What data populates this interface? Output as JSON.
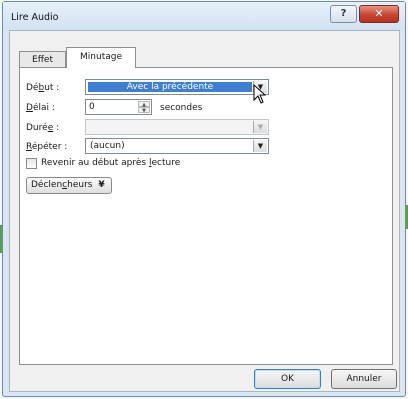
{
  "window": {
    "title": "Lire Audio",
    "help_label": "?",
    "close_label": "✕"
  },
  "tabs": [
    {
      "label": "Effet"
    },
    {
      "label": "Minutage"
    }
  ],
  "form": {
    "debut": {
      "label_pre": "Dé",
      "label_key": "b",
      "label_post": "ut :",
      "value": "Avec la précédente"
    },
    "delai": {
      "label_key": "D",
      "label_post": "élai :",
      "value": "0",
      "unit": "secondes"
    },
    "duree": {
      "label_pre": "Duré",
      "label_key": "e",
      "label_post": " :",
      "value": ""
    },
    "repeter": {
      "label_key": "R",
      "label_post": "épéter :",
      "value": "(aucun)"
    },
    "rewind": {
      "label_pre": "Revenir au début après ",
      "label_key": "l",
      "label_post": "ecture",
      "checked": false
    }
  },
  "triggers": {
    "label_pre": "Déclen",
    "label_key": "c",
    "label_post": "heurs",
    "arrow": "¥"
  },
  "buttons": {
    "ok": "OK",
    "cancel": "Annuler"
  }
}
